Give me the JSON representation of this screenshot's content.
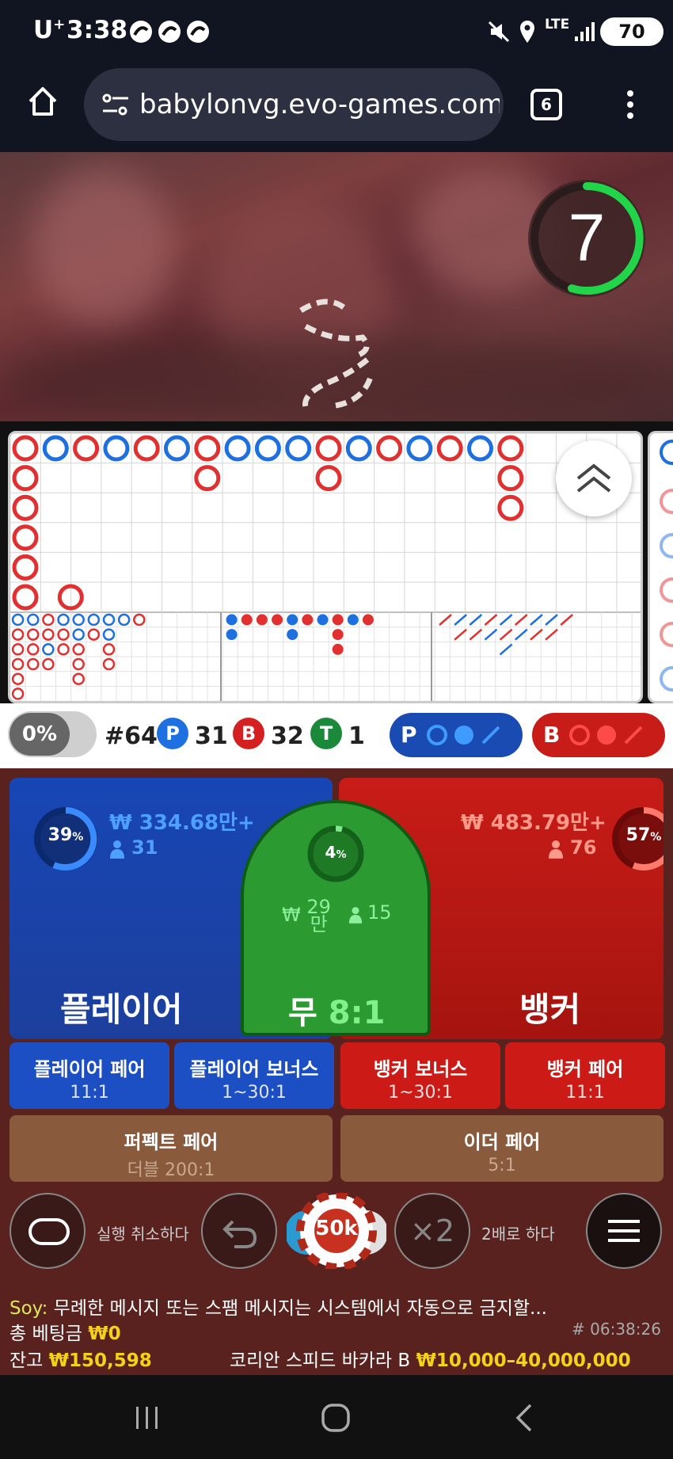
{
  "status": {
    "carrier": "U",
    "carrier_sup": "+",
    "time": "3:38",
    "network": "LTE",
    "battery": "70"
  },
  "browser": {
    "url": "babylonvg.evo-games.com/t",
    "tabs": "6"
  },
  "video": {
    "countdown": "7"
  },
  "stats": {
    "percent": "0%",
    "round": "#64",
    "p_label": "P",
    "p_count": "31",
    "b_label": "B",
    "b_count": "32",
    "t_label": "T",
    "t_count": "1"
  },
  "predict": {
    "player_label": "P",
    "banker_label": "B"
  },
  "bets": {
    "player": {
      "label": "플레이어",
      "percent": "39",
      "pct_sym": "%",
      "amount": "₩ 334.68만+",
      "players": "31"
    },
    "banker": {
      "label": "뱅커",
      "percent": "57",
      "pct_sym": "%",
      "amount": "₩ 483.79만+",
      "players": "76"
    },
    "tie": {
      "label": "무",
      "odds": "8:1",
      "percent": "4",
      "pct_sym": "%",
      "amount_a": "₩",
      "amount_b": "29",
      "amount_c": "만",
      "players": "15"
    },
    "player_pair": {
      "label": "플레이어 페어",
      "odds": "11:1"
    },
    "player_bonus": {
      "label": "플레이어 보너스",
      "odds": "1~30:1"
    },
    "banker_bonus": {
      "label": "뱅커 보너스",
      "odds": "1~30:1"
    },
    "banker_pair": {
      "label": "뱅커 페어",
      "odds": "11:1"
    },
    "perfect_pair": {
      "label": "퍼펙트 페어",
      "odds": "더블 200:1"
    },
    "either_pair": {
      "label": "이더 페어",
      "odds": "5:1"
    }
  },
  "controls": {
    "undo_label": "실행 취소하다",
    "chip_value": "50k",
    "double_icon": "×2",
    "double_label": "2배로 하다"
  },
  "chat": {
    "user": "Soy:",
    "message": " 무례한 메시지 또는 스팸 메시지는 시스템에서 자동으로 금지할..."
  },
  "footer": {
    "total_bet_label": "총 베팅금",
    "total_bet": "₩0",
    "time": "# 06:38:26",
    "balance_label": "잔고",
    "balance": "₩150,598",
    "table_name": "코리안 스피드 바카라 B",
    "limits": "₩10,000–40,000,000"
  },
  "colors": {
    "player": "#1d4fc4",
    "banker": "#d01e1a",
    "tie": "#2a9a31",
    "gold": "#f5d21a"
  }
}
